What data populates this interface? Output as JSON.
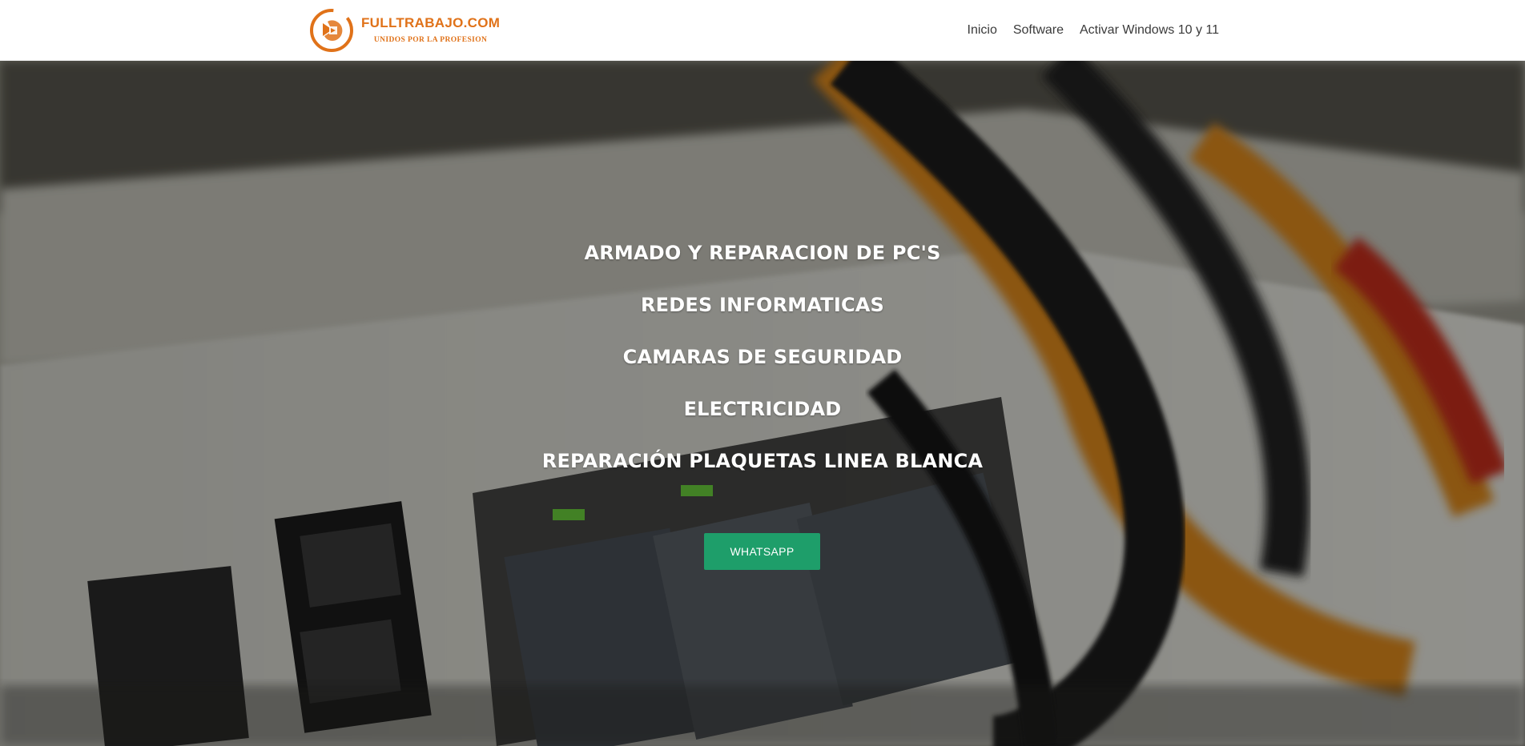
{
  "brand": {
    "name": "FULLTRABAJO.COM",
    "tagline": "UNIDOS POR LA PROFESION",
    "accent": "#e07219",
    "icon": "logo-hands-icon"
  },
  "nav": {
    "items": [
      {
        "label": "Inicio"
      },
      {
        "label": "Software"
      },
      {
        "label": "Activar Windows 10 y 11"
      }
    ]
  },
  "hero": {
    "background": "network-switch-ethernet-cables-photo",
    "services": [
      "ARMADO Y REPARACION DE PC'S",
      "REDES INFORMATICAS",
      "CAMARAS DE SEGURIDAD",
      "ELECTRICIDAD",
      "REPARACIÓN PLAQUETAS LINEA BLANCA"
    ],
    "cta_label": "WHATSAPP",
    "cta_color": "#1e9e6a"
  }
}
